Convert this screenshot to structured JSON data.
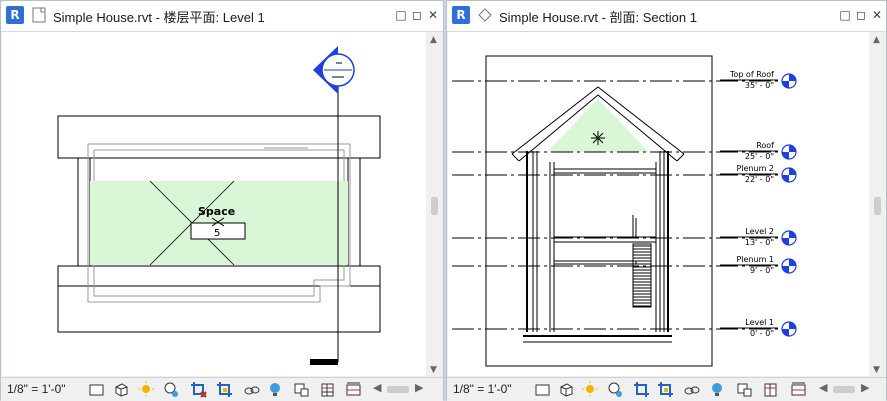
{
  "windows": {
    "left": {
      "app_icon": "R",
      "doc_icon": "floor-plan-icon",
      "title": "Simple House.rvt - 楼层平面: Level 1",
      "scale": "1/8\" = 1'-0\"",
      "space_label": "Space",
      "space_number": "5",
      "section_marker": "section-head-marker"
    },
    "right": {
      "app_icon": "R",
      "doc_icon": "section-view-icon",
      "title": "Simple House.rvt - 剖面: Section 1",
      "scale": "1/8\" = 1'-0\"",
      "levels": [
        {
          "name": "Top of Roof",
          "elevation": "35' - 0\""
        },
        {
          "name": "Roof",
          "elevation": "25' - 0\""
        },
        {
          "name": "Plenum 2",
          "elevation": "22' - 0\""
        },
        {
          "name": "Level 2",
          "elevation": "13' - 0\""
        },
        {
          "name": "Plenum 1",
          "elevation": "9' - 0\""
        },
        {
          "name": "Level 1",
          "elevation": "0' - 0\""
        }
      ]
    }
  },
  "window_buttons": {
    "minimize": "□",
    "restore": "◻",
    "close": "✕"
  },
  "status_icons": [
    "detail-level-icon",
    "visual-style-icon",
    "sun-path-icon",
    "shadows-icon",
    "crop-view-icon",
    "show-crop-region-icon",
    "temporary-hide-icon",
    "reveal-hidden-icon",
    "lock-3d-icon",
    "analytical-model-icon",
    "highlight-displacement-icon"
  ],
  "colors": {
    "space_fill": "#d9f7d6",
    "section_marker": "#1f3fe0",
    "revit_blue": "#2f6fd6"
  }
}
